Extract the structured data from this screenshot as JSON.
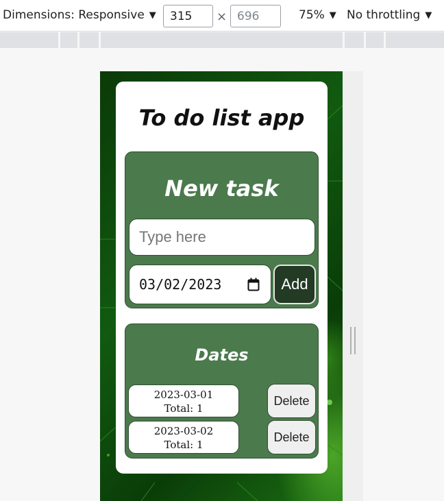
{
  "devtools": {
    "dimensions_label": "Dimensions: Responsive",
    "width": "315",
    "height": "696",
    "times": "×",
    "zoom": "75%",
    "throttling": "No throttling",
    "caret": "▼"
  },
  "app": {
    "title": "To do list app",
    "new_task": {
      "heading": "New task",
      "input_placeholder": "Type here",
      "date_value": "03/02/2023",
      "add_label": "Add"
    },
    "dates": {
      "heading": "Dates",
      "items": [
        {
          "date": "2023-03-01",
          "total": "Total: 1",
          "delete_label": "Delete"
        },
        {
          "date": "2023-03-02",
          "total": "Total: 1",
          "delete_label": "Delete"
        }
      ]
    }
  },
  "colors": {
    "panel": "#4b7a4c",
    "add_button": "#233a25",
    "background": "#115a10"
  },
  "icons": {
    "calendar": "calendar-icon",
    "dropdown": "chevron-down-icon"
  }
}
